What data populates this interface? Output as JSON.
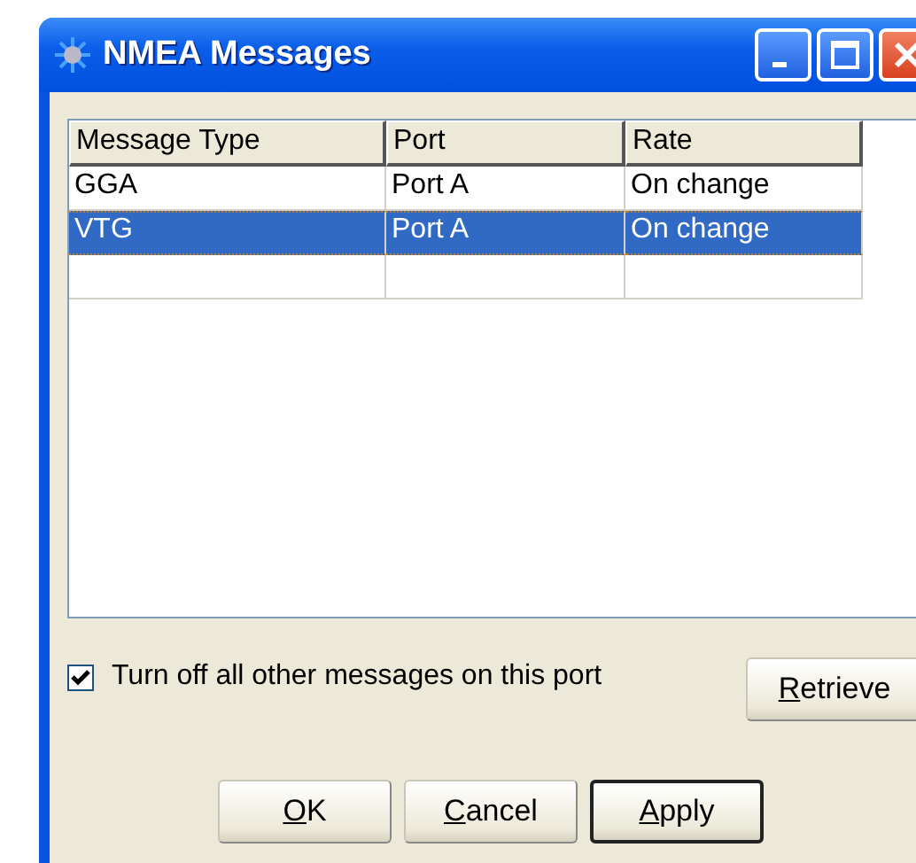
{
  "window": {
    "title": "NMEA Messages"
  },
  "table": {
    "columns": [
      "Message Type",
      "Port",
      "Rate"
    ],
    "rows": [
      {
        "cells": [
          "GGA",
          "Port A",
          "On change"
        ],
        "selected": false
      },
      {
        "cells": [
          "VTG",
          "Port A",
          "On change"
        ],
        "selected": true
      }
    ]
  },
  "checkbox": {
    "label": "Turn off all other messages on this port",
    "checked": true
  },
  "side_button": {
    "label": "Retrieve",
    "mnemonic_underlined": true,
    "default": false
  },
  "buttons": [
    {
      "label": "OK",
      "mnemonic_underlined": true,
      "default": false
    },
    {
      "label": "Cancel",
      "mnemonic_underlined": true,
      "default": false
    },
    {
      "label": "Apply",
      "mnemonic_underlined": true,
      "default": true
    }
  ]
}
